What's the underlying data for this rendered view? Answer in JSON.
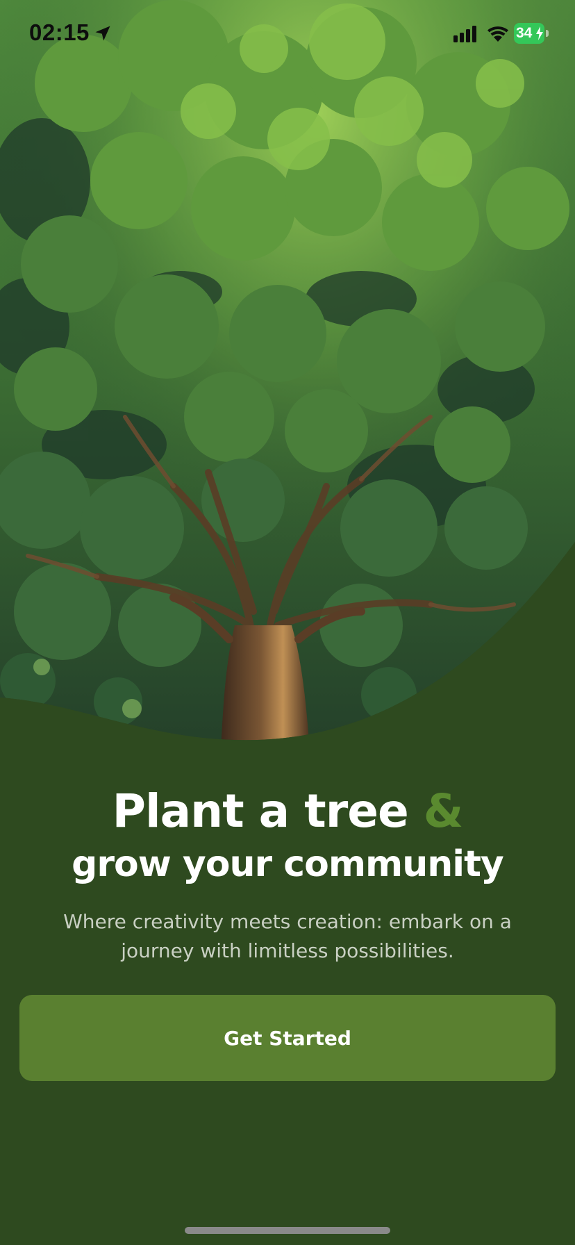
{
  "status_bar": {
    "time": "02:15",
    "battery_level": "34",
    "location_icon": "location-arrow-icon",
    "signal_icon": "cellular-signal-icon",
    "wifi_icon": "wifi-icon",
    "battery_icon": "battery-charging-icon"
  },
  "hero": {
    "illustration": "tree-illustration"
  },
  "content": {
    "headline_main": "Plant a tree",
    "headline_amp": "&",
    "subheadline": "grow your community",
    "description": "Where creativity meets creation: embark on a journey with limitless possibilities."
  },
  "cta": {
    "label": "Get Started"
  },
  "colors": {
    "background": "#2e4a1f",
    "accent": "#5a8a2f",
    "button": "#5a8030",
    "text_primary": "#ffffff",
    "text_secondary": "#c9d0c3",
    "battery": "#34c759"
  }
}
